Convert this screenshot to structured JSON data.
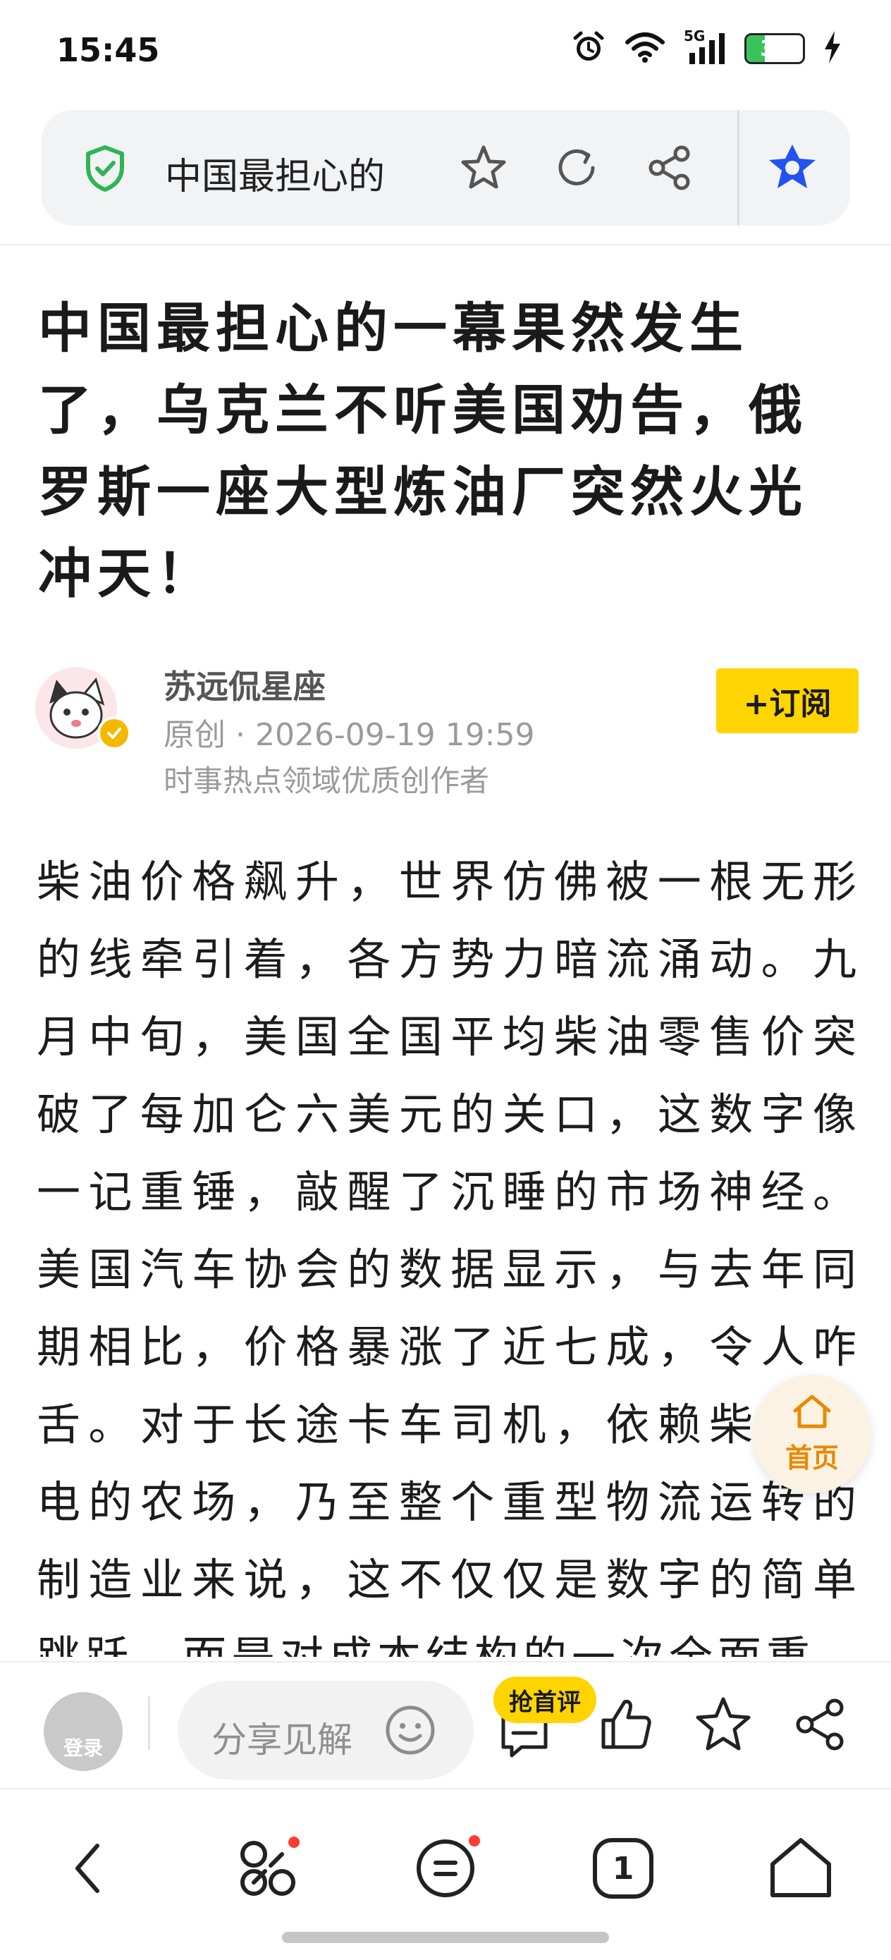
{
  "status_bar": {
    "time": "15:45",
    "network": "5G",
    "battery": "33",
    "battery_level_percent": 33
  },
  "address_bar": {
    "title": "中国最担心的",
    "icons": [
      "shield-check-icon",
      "star-icon",
      "refresh-icon",
      "share-icon",
      "ai-assistant-icon"
    ]
  },
  "article": {
    "title": "中国最担心的一幕果然发生了，乌克兰不听美国劝告，俄罗斯一座大型炼油厂突然火光冲天！",
    "author": {
      "name": "苏远侃星座",
      "meta": "原创 · 2026-09-19 19:59",
      "desc": "时事热点领域优质创作者",
      "follow_label": "+订阅"
    },
    "body": "柴油价格飙升，世界仿佛被一根无形的线牵引着，各方势力暗流涌动。九月中旬，美国全国平均柴油零售价突破了每加仑六美元的关口，这数字像一记重锤，敲醒了沉睡的市场神经。美国汽车协会的数据显示，与去年同期相比，价格暴涨了近七成，令人咋舌。对于长途卡车司机，依赖柴油发电的农场，乃至整个重型物流运转的制造业来说，这不仅仅是数字的简单跳跃，而是对成本结构的一次全面重"
  },
  "floating_home": {
    "label": "首页"
  },
  "comment_bar": {
    "login_label": "登录",
    "share_placeholder": "分享见解",
    "first_comment_badge": "抢首评"
  },
  "nav_bar": {
    "tab_count": "1",
    "items": [
      "back-icon",
      "apps-icon",
      "messages-icon",
      "tabs-icon",
      "home-icon"
    ]
  },
  "colors": {
    "accent_yellow": "#ffd400",
    "shield_green": "#2fb455",
    "ai_blue": "#2452f0",
    "home_orange": "#e88a00",
    "notification_red": "#ff3b30"
  }
}
